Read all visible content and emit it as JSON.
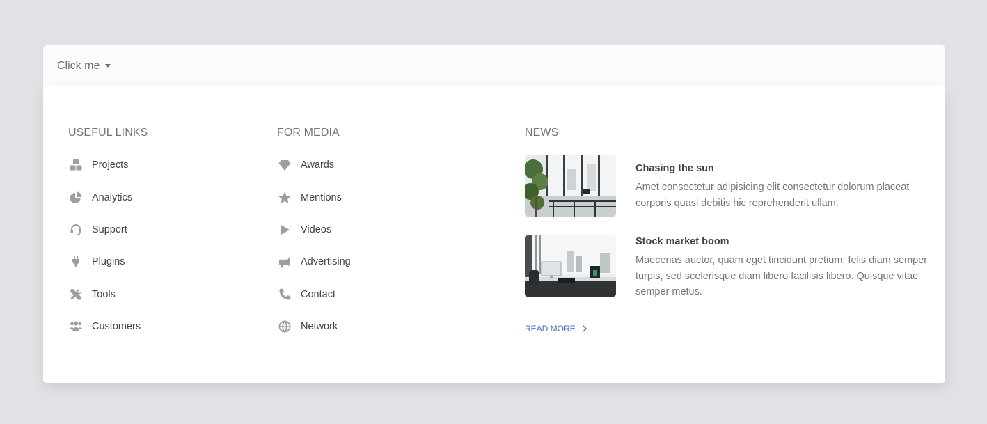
{
  "navbar": {
    "toggle_label": "Click me"
  },
  "useful_links": {
    "heading": "USEFUL LINKS",
    "items": [
      {
        "label": "Projects",
        "icon": "cubes-icon"
      },
      {
        "label": "Analytics",
        "icon": "pie-chart-icon"
      },
      {
        "label": "Support",
        "icon": "headset-icon"
      },
      {
        "label": "Plugins",
        "icon": "plug-icon"
      },
      {
        "label": "Tools",
        "icon": "tools-icon"
      },
      {
        "label": "Customers",
        "icon": "users-icon"
      }
    ]
  },
  "for_media": {
    "heading": "FOR MEDIA",
    "items": [
      {
        "label": "Awards",
        "icon": "gem-icon"
      },
      {
        "label": "Mentions",
        "icon": "star-icon"
      },
      {
        "label": "Videos",
        "icon": "play-icon"
      },
      {
        "label": "Advertising",
        "icon": "bullhorn-icon"
      },
      {
        "label": "Contact",
        "icon": "phone-icon"
      },
      {
        "label": "Network",
        "icon": "globe-icon"
      }
    ]
  },
  "news": {
    "heading": "NEWS",
    "items": [
      {
        "title": "Chasing the sun",
        "description": "Amet consectetur adipisicing elit consectetur dolorum placeat corporis quasi debitis hic reprehenderit ullam."
      },
      {
        "title": "Stock market boom",
        "description": "Maecenas auctor, quam eget tincidunt pretium, felis diam semper turpis, sed scelerisque diam libero facilisis libero. Quisque vitae semper metus."
      }
    ],
    "read_more": "READ MORE"
  },
  "colors": {
    "accent": "#3f6fbf",
    "icon": "#9e9e9e",
    "text": "#424242",
    "muted": "#757575",
    "background": "#e0e2e6"
  }
}
